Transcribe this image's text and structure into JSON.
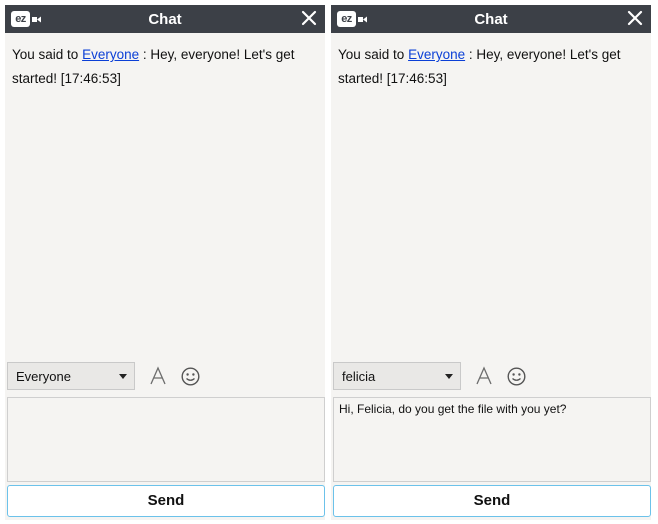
{
  "panels": [
    {
      "title": "Chat",
      "logo_text": "ez",
      "message": {
        "prefix": "You said to ",
        "recipient": "Everyone",
        "text": " : Hey, everyone! Let's get started! [17:46:53]"
      },
      "recipient_select": "Everyone",
      "input_value": "",
      "send_label": "Send"
    },
    {
      "title": "Chat",
      "logo_text": "ez",
      "message": {
        "prefix": "You said to ",
        "recipient": "Everyone",
        "text": " : Hey, everyone! Let's get started! [17:46:53]"
      },
      "recipient_select": "felicia",
      "input_value": "Hi, Felicia, do you get the file with you yet?",
      "send_label": "Send"
    }
  ],
  "colors": {
    "titlebar": "#3c4047",
    "panel_bg": "#f5f4f2",
    "link": "#0b3fd6",
    "send_border": "#6cc2ea"
  }
}
